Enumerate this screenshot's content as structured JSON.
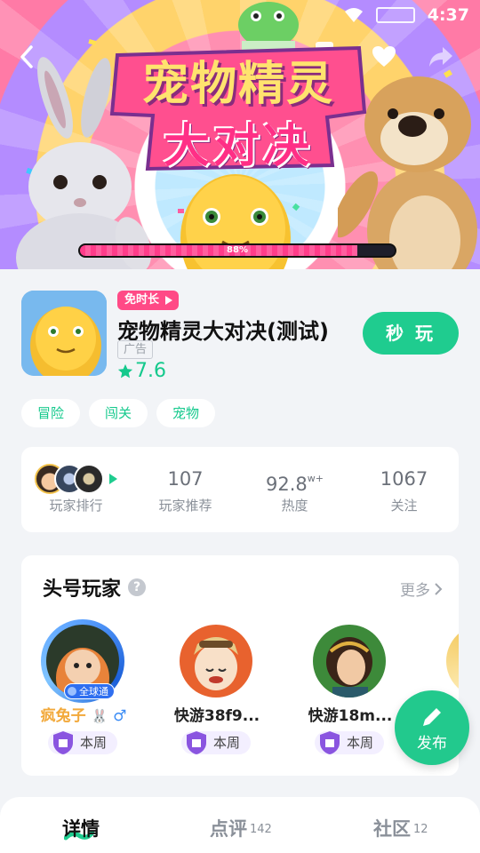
{
  "status_bar": {
    "time": "4:37"
  },
  "banner": {
    "title_line1": "宠物精灵",
    "title_line2": "大对决",
    "progress_label": "88%",
    "progress": 0.88
  },
  "game": {
    "promo_tag": "免时长",
    "name": "宠物精灵大对决(测试)",
    "ad_label": "广告",
    "rating": "7.6",
    "play_button": "秒 玩"
  },
  "tags": [
    "冒险",
    "闯关",
    "宠物"
  ],
  "stats": [
    {
      "label": "玩家排行",
      "value": ""
    },
    {
      "label": "玩家推荐",
      "value": "107"
    },
    {
      "label": "热度",
      "value": "92.8",
      "suffix": "w+"
    },
    {
      "label": "关注",
      "value": "1067"
    }
  ],
  "top_players": {
    "title": "头号玩家",
    "more": "更多",
    "global_badge": "全球通",
    "items": [
      {
        "name": "疯兔子",
        "week": "本周"
      },
      {
        "name": "快游38f9...",
        "week": "本周"
      },
      {
        "name": "快游18m...",
        "week": "本周"
      }
    ]
  },
  "fab": {
    "label": "发布"
  },
  "tabs": [
    {
      "label": "详情",
      "count": ""
    },
    {
      "label": "点评",
      "count": "142"
    },
    {
      "label": "社区",
      "count": "12"
    }
  ],
  "colors": {
    "accent": "#1fcc8f",
    "promo": "#ff4a86",
    "progress": "#ff3c8a"
  }
}
